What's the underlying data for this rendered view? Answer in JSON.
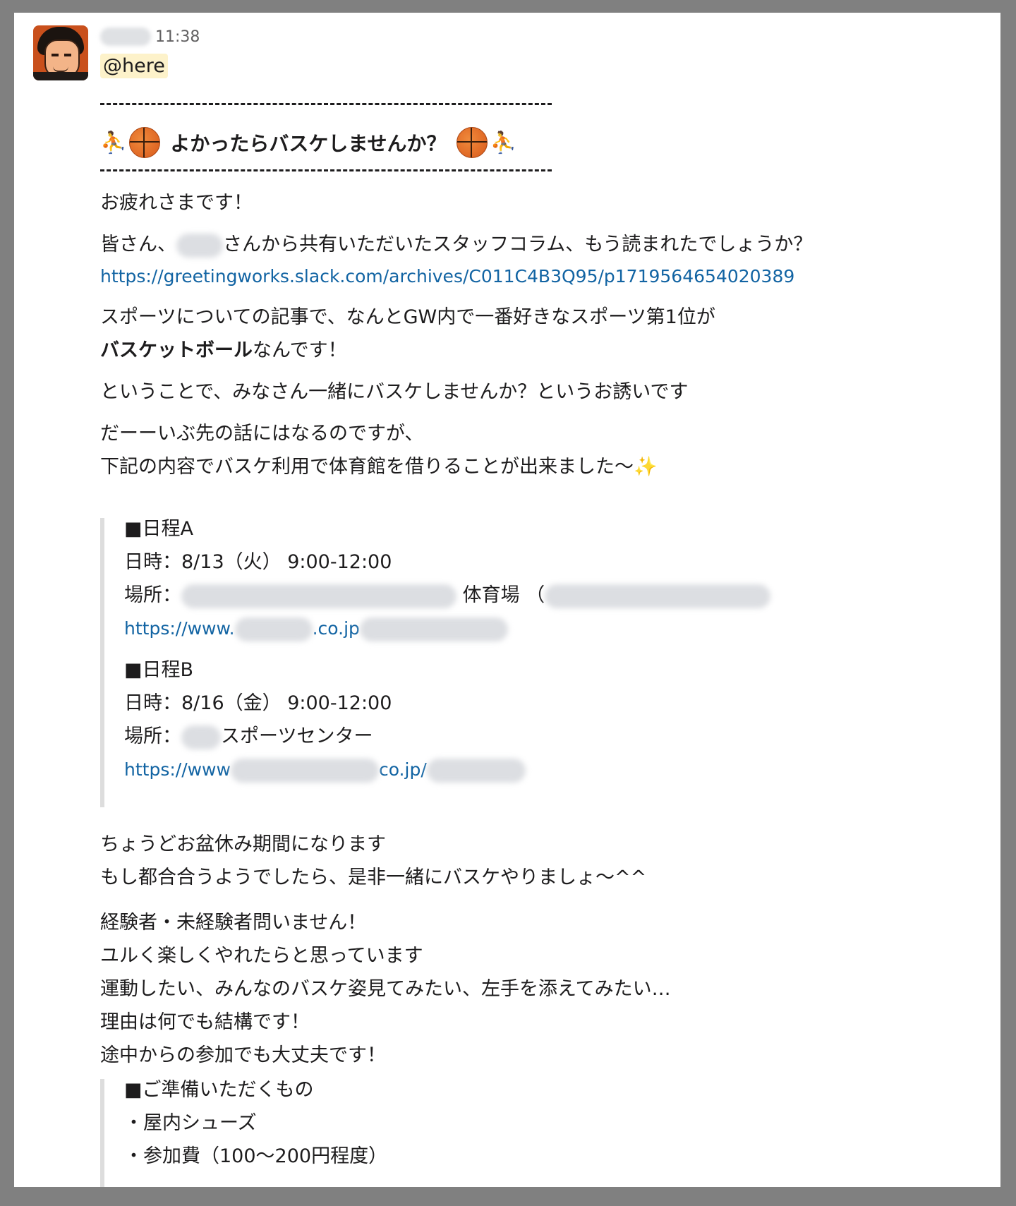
{
  "message": {
    "timestamp": "11:38",
    "mention": "@here",
    "title": "よかったらバスケしませんか？",
    "title_emoji_left": "⛹️‍♂️🏀",
    "title_emoji_right": "🏀⛹️‍♀️",
    "greeting": "お疲れさまです！",
    "line_share_prefix": "皆さん、",
    "line_share_suffix": "さんから共有いただいたスタッフコラム、もう読まれたでしょうか？",
    "share_link": "https://greetingworks.slack.com/archives/C011C4B3Q95/p1719564654020389",
    "sports_line1": "スポーツについての記事で、なんとGW内で一番好きなスポーツ第1位が",
    "sports_line2_bold": "バスケットボール",
    "sports_line2_rest": "なんです！",
    "invite_line": "ということで、みなさん一緒にバスケしませんか？というお誘いです",
    "future_line1": "だーーいぶ先の話にはなるのですが、",
    "future_line2": "下記の内容でバスケ利用で体育館を借りることが出来ました〜",
    "sparkle": "✨",
    "schedule_a": {
      "heading": "■日程A",
      "datetime": "日時：8/13（火） 9:00-12:00",
      "place_label": "場所：",
      "place_suffix": "体育場 （",
      "link_prefix": "https://www.",
      "link_mid": ".co.jp"
    },
    "schedule_b": {
      "heading": "■日程B",
      "datetime": "日時：8/16（金） 9:00-12:00",
      "place_label": "場所：",
      "place_suffix": "スポーツセンター",
      "link_prefix": "https://www",
      "link_mid": "co.jp/"
    },
    "obon_line1": "ちょうどお盆休み期間になります",
    "obon_line2": "もし都合合うようでしたら、是非一緒にバスケやりましょ〜^^",
    "welcome_lines": [
      "経験者・未経験者問いません！",
      "ユルく楽しくやれたらと思っています",
      "運動したい、みんなのバスケ姿見てみたい、左手を添えてみたい…",
      "理由は何でも結構です！",
      "途中からの参加でも大丈夫です！"
    ],
    "prep": {
      "heading": "■ご準備いただくもの",
      "items": [
        "・屋内シューズ",
        "・参加費（100〜200円程度）"
      ]
    }
  }
}
